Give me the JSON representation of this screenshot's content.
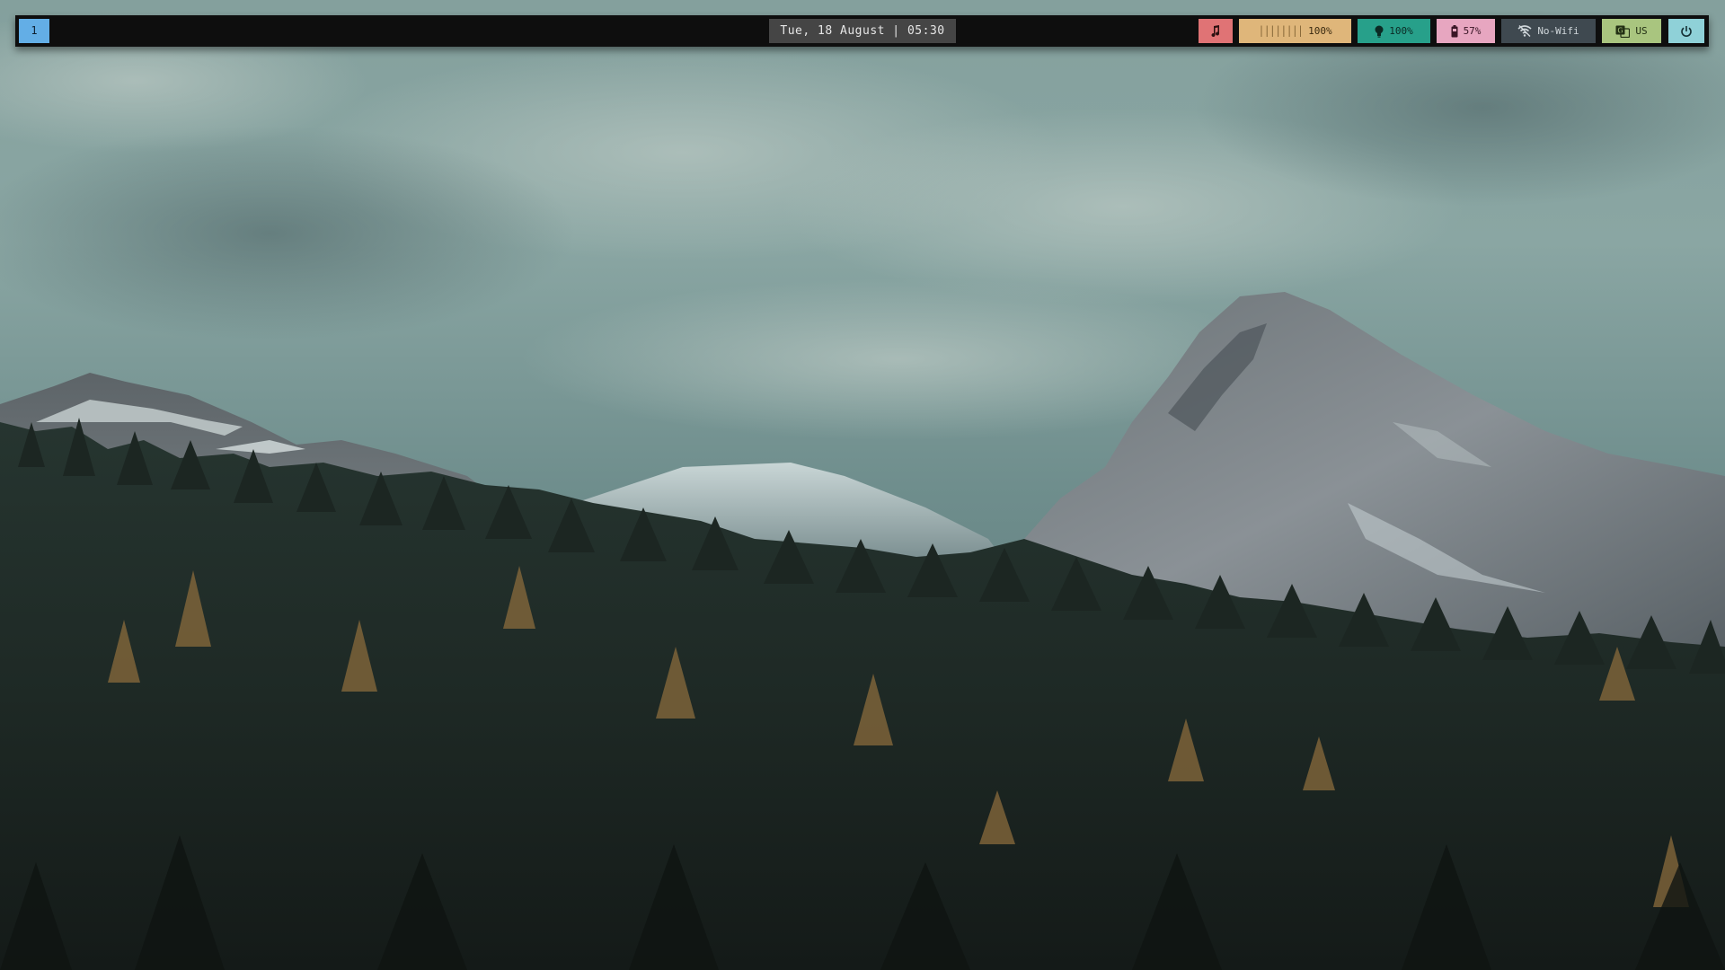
{
  "bar": {
    "workspace": "1",
    "clock": "Tue, 18 August | 05:30",
    "music_icon": "music-note-icon",
    "volume": {
      "bars": "||||||||",
      "value": "100%"
    },
    "brightness": {
      "icon": "lightbulb-icon",
      "value": "100%"
    },
    "battery": {
      "icon": "battery-icon",
      "value": "57%"
    },
    "wifi": {
      "icon": "wifi-off-icon",
      "label": "No-Wifi"
    },
    "keyboard": {
      "icon": "keyboard-language-icon",
      "layout": "US"
    },
    "power_icon": "power-icon"
  },
  "colors": {
    "bar_bg": "#0e0e0e",
    "workspace": "#63aee6",
    "clock_bg": "#454545",
    "music": "#e07375",
    "volume": "#dfb67a",
    "brightness": "#27a08a",
    "battery": "#e7a6c0",
    "wifi": "#3f4950",
    "keyboard": "#a9c57f",
    "power": "#8fd1d8"
  }
}
